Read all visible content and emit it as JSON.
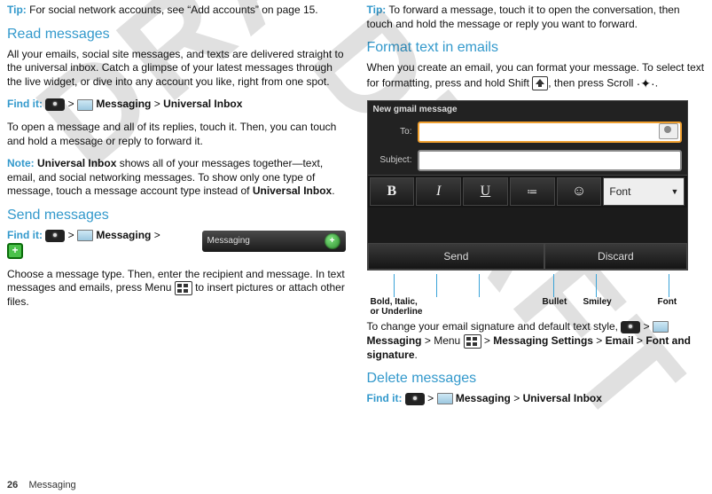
{
  "left": {
    "tip1a": "Tip:",
    "tip1b": " For social network accounts, see “Add accounts” on page 15.",
    "read_head": "Read messages",
    "read_body": "All your emails, social site messages, and texts are delivered straight to the universal inbox. Catch a glimpse of your latest messages through the live widget, or dive into any account you like, right from one spot.",
    "findit1": "Find it:",
    "findit1_path_a": " Messaging",
    "findit1_path_b": "Universal Inbox",
    "open_body": "To open a message and all of its replies, touch it. Then, you can touch and hold a message or reply to forward it.",
    "note_a": "Note:",
    "note_b": " Universal Inbox",
    "note_c": " shows all of your messages together—text, email, and social networking messages. To show only one type of message, touch a message account type instead of ",
    "note_d": "Universal Inbox",
    "note_e": ".",
    "send_head": "Send messages",
    "findit2": "Find it:",
    "findit2_path_a": " Messaging",
    "compose_label": "Messaging",
    "choose_a": "Choose a message type. Then, enter the recipient and message. In text messages and emails, press Menu ",
    "choose_b": " to insert pictures or attach other files."
  },
  "right": {
    "tip2a": "Tip:",
    "tip2b": " To forward a message, touch it to open the conversation, then touch and hold the message or reply you want to forward.",
    "format_head": "Format text in emails",
    "format_body_a": "When you create an email, you can format your message. To select text for formatting, press and hold Shift ",
    "format_body_b": ", then press Scroll ",
    "format_body_c": ".",
    "compose": {
      "title": "New gmail message",
      "to": "To:",
      "subject": "Subject:",
      "font_btn": "Font",
      "send": "Send",
      "discard": "Discard"
    },
    "callouts": {
      "biu": "Bold, Italic,\n or Underline",
      "bullet": "Bullet",
      "smiley": "Smiley",
      "font": "Font"
    },
    "change_a": "To change your email signature and default text style, ",
    "change_b": " Messaging",
    "change_c": "Menu",
    "change_d": "Messaging Settings",
    "change_e": "Email",
    "change_f": "Font and signature",
    "delete_head": "Delete messages",
    "findit3": "Find it:",
    "findit3_path_a": " Messaging",
    "findit3_path_b": "Universal Inbox"
  },
  "footer": {
    "page": "26",
    "section": "Messaging"
  }
}
